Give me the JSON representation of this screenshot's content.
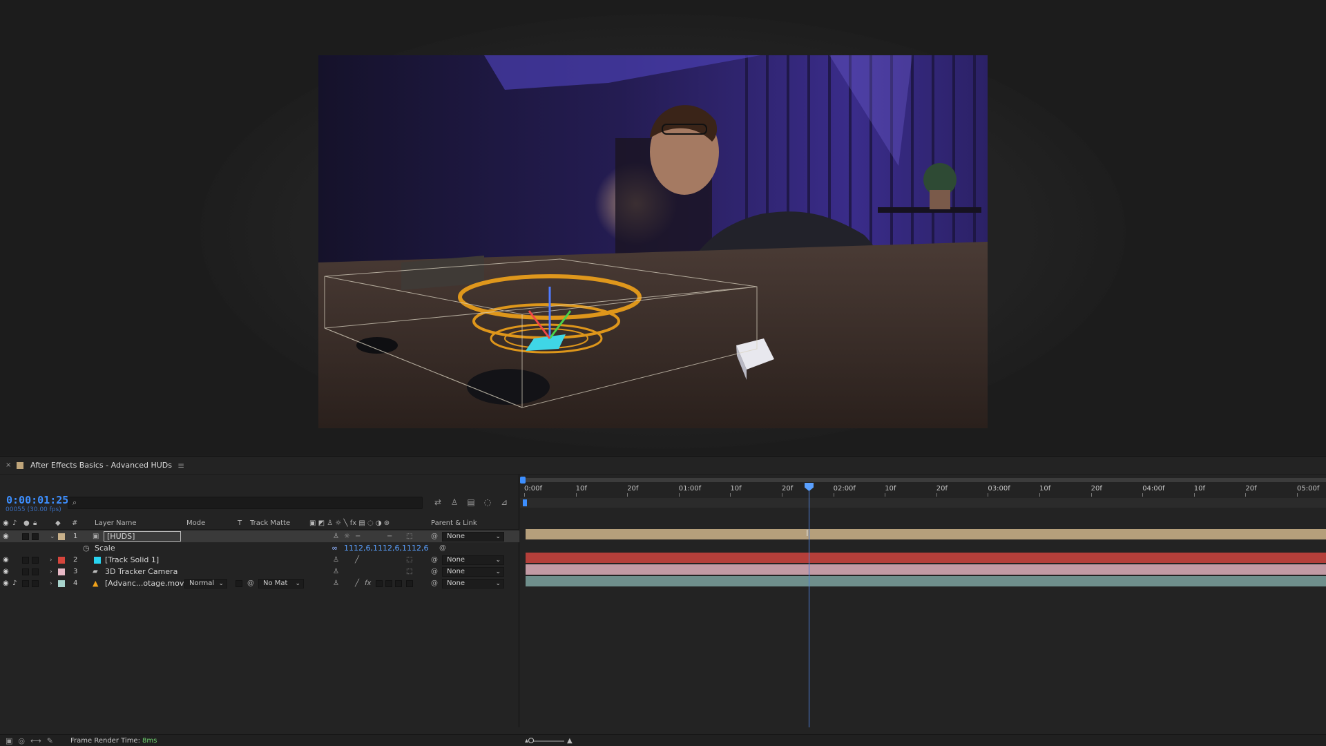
{
  "panel": {
    "close_label": "×",
    "title": "After Effects Basics - Advanced HUDs",
    "menu_label": "≡"
  },
  "timecode": {
    "current": "0:00:01:25",
    "frames": "00055 (30.00 fps)"
  },
  "search": {
    "placeholder": ""
  },
  "columns": {
    "number": "#",
    "layer_name": "Layer Name",
    "mode": "Mode",
    "t": "T",
    "track_matte": "Track Matte",
    "parent_link": "Parent & Link"
  },
  "layers": [
    {
      "num": "1",
      "name": "[HUDS]",
      "label_color": "#c8b08a",
      "parent": "None",
      "selected": true,
      "expanded": true
    },
    {
      "num": "2",
      "name": "[Track Solid 1]",
      "label_color": "#d6453c",
      "parent": "None",
      "icon_color": "#29d4f0"
    },
    {
      "num": "3",
      "name": "3D Tracker Camera",
      "label_color": "#e8b9c6",
      "parent": "None"
    },
    {
      "num": "4",
      "name": "[Advanc...otage.mov]",
      "label_color": "#a7d3cc",
      "parent": "None",
      "mode": "Normal",
      "track_matte": "No Mat"
    }
  ],
  "property": {
    "name": "Scale",
    "value": "1112,6,1112,6,1112,6"
  },
  "ruler": {
    "labels": [
      "0:00f",
      "10f",
      "20f",
      "01:00f",
      "10f",
      "20f",
      "02:00f",
      "10f",
      "20f",
      "03:00f",
      "10f",
      "20f",
      "04:00f",
      "10f",
      "20f",
      "05:00f"
    ]
  },
  "track_colors": {
    "huds": "#b59f7b",
    "solid": "#b43f3a",
    "camera": "#c29aa4",
    "footage": "#6f8f8c"
  },
  "status": {
    "frame_render_label": "Frame Render Time:",
    "frame_render_value": "8ms"
  },
  "colors": {
    "accent": "#3d8fff",
    "render_ok": "#6fd36f"
  }
}
